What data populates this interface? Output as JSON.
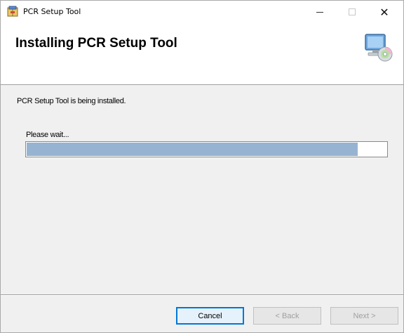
{
  "window": {
    "title": "PCR Setup Tool",
    "controls": {
      "minimize": "–",
      "close": "✕"
    }
  },
  "banner": {
    "heading": "Installing PCR Setup Tool",
    "icon": "computer-install-icon"
  },
  "status": {
    "message": "PCR Setup Tool is being installed.",
    "wait_label": "Please wait...",
    "progress_fraction": 0.92
  },
  "buttons": {
    "cancel": "Cancel",
    "back": "< Back",
    "next": "Next >"
  },
  "colors": {
    "progress_fill": "#97b3d2",
    "focus_border": "#0078d7"
  }
}
